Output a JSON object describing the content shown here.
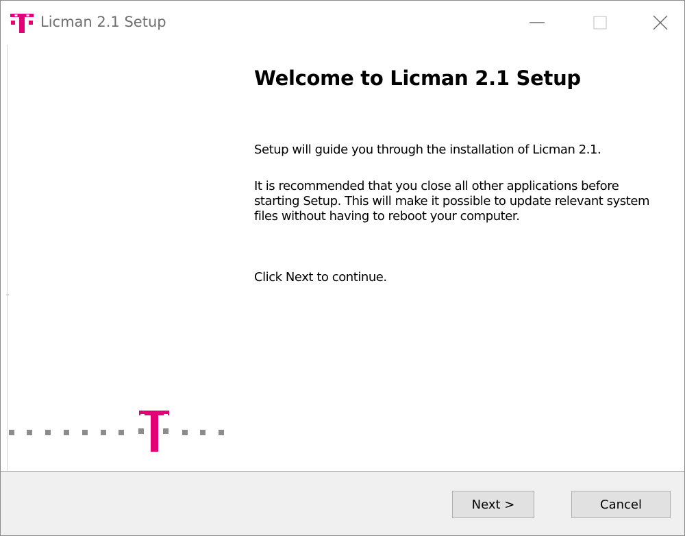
{
  "window": {
    "title": "Licman 2.1 Setup",
    "icon": "telekom-t-icon",
    "controls": [
      "minimize-icon",
      "maximize-icon",
      "close-icon"
    ]
  },
  "main": {
    "heading": "Welcome to Licman 2.1 Setup",
    "paragraphs": [
      "Setup will guide you through the installation of Licman 2.1.",
      "It is recommended that you close all other applications before starting Setup. This will make it possible to update relevant system files without having to reboot your computer.",
      "Click Next to continue."
    ]
  },
  "footer": {
    "next_label": "Next >",
    "cancel_label": "Cancel"
  },
  "colors": {
    "brand_magenta": "#e20074",
    "dots_gray": "#8c8c8c"
  }
}
